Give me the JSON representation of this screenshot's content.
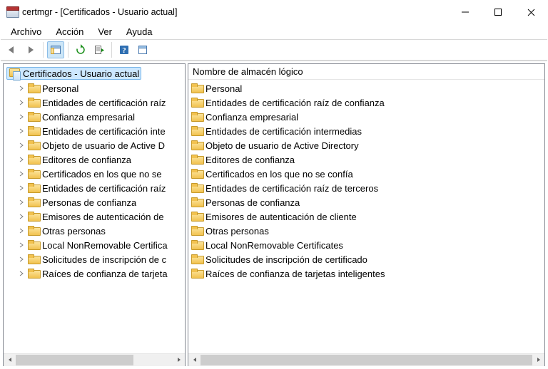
{
  "titlebar": {
    "title": "certmgr - [Certificados - Usuario actual]"
  },
  "menu": {
    "items": [
      "Archivo",
      "Acción",
      "Ver",
      "Ayuda"
    ]
  },
  "toolbar": {
    "back": "back-icon",
    "forward": "forward-icon",
    "up": "show-hide-tree-icon",
    "refresh": "refresh-icon",
    "export": "export-list-icon",
    "help": "help-icon",
    "properties": "properties-icon"
  },
  "tree": {
    "root_label": "Certificados - Usuario actual",
    "items": [
      "Personal",
      "Entidades de certificación raíz",
      "Confianza empresarial",
      "Entidades de certificación inte",
      "Objeto de usuario de Active D",
      "Editores de confianza",
      "Certificados en los que no se ",
      "Entidades de certificación raíz",
      "Personas de confianza",
      "Emisores de autenticación de ",
      "Otras personas",
      "Local NonRemovable Certifica",
      "Solicitudes de inscripción de c",
      "Raíces de confianza de tarjeta"
    ]
  },
  "list": {
    "column_header": "Nombre de almacén lógico",
    "items": [
      "Personal",
      "Entidades de certificación raíz de confianza",
      "Confianza empresarial",
      "Entidades de certificación intermedias",
      "Objeto de usuario de Active Directory",
      "Editores de confianza",
      "Certificados en los que no se confía",
      "Entidades de certificación raíz de terceros",
      "Personas de confianza",
      "Emisores de autenticación de cliente",
      "Otras personas",
      "Local NonRemovable Certificates",
      "Solicitudes de inscripción de certificado",
      "Raíces de confianza de tarjetas inteligentes"
    ]
  }
}
